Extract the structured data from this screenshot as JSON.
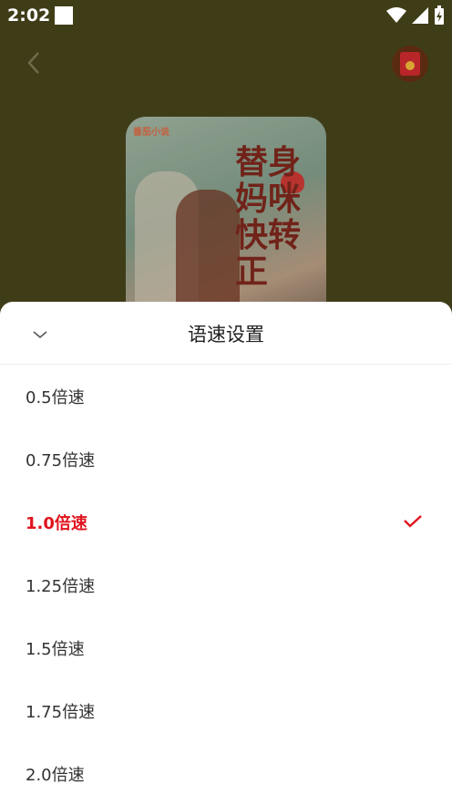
{
  "status_bar": {
    "time": "2:02"
  },
  "background_page": {
    "icons": [
      "back-icon",
      "red-envelope-icon"
    ],
    "cover": {
      "brand": "番茄小说",
      "title": "替身妈咪快转正"
    }
  },
  "speed_sheet": {
    "title": "语速设置",
    "options": [
      {
        "label": "0.5倍速",
        "selected": false
      },
      {
        "label": "0.75倍速",
        "selected": false
      },
      {
        "label": "1.0倍速",
        "selected": true
      },
      {
        "label": "1.25倍速",
        "selected": false
      },
      {
        "label": "1.5倍速",
        "selected": false
      },
      {
        "label": "1.75倍速",
        "selected": false
      },
      {
        "label": "2.0倍速",
        "selected": false
      }
    ],
    "accent_color": "#e0141e"
  }
}
